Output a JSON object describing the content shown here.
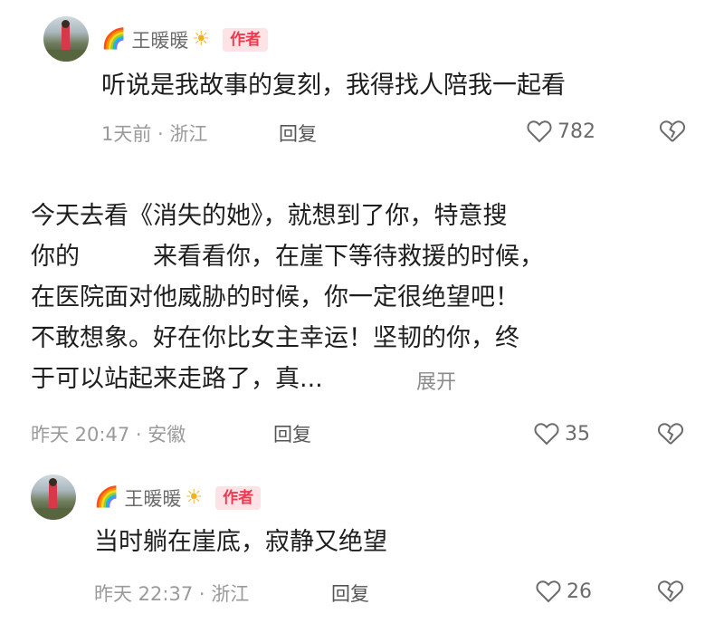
{
  "comments": [
    {
      "username": "王暖暖",
      "badge": "作者",
      "text_lines": [
        "听说是我故事的复刻，我得找人陪我一起看"
      ],
      "time_location": "1天前 · 浙江",
      "reply_label": "回复",
      "likes": "782"
    },
    {
      "text_lines": [
        "今天去看《消失的她》，就想到了你，特意搜",
        "你的　　　来看看你，在崖下等待救援的时候，",
        "在医院面对他威胁的时候，你一定很绝望吧！",
        "不敢想象。好在你比女主幸运！坚韧的你，终",
        "于可以站起来走路了，真..."
      ],
      "expand_label": "展开",
      "time_location": "昨天 20:47 · 安徽",
      "reply_label": "回复",
      "likes": "35"
    },
    {
      "username": "王暖暖",
      "badge": "作者",
      "text_lines": [
        "当时躺在崖底，寂静又绝望"
      ],
      "time_location": "昨天 22:37 · 浙江",
      "reply_label": "回复",
      "likes": "26"
    }
  ],
  "icons": {
    "rainbow": "🌈",
    "sun": "☀",
    "heart": "heart-icon",
    "dislike": "broken-heart-icon"
  },
  "colors": {
    "badge_text": "#f2384e",
    "badge_bg": "#fde3e6",
    "meta": "#9a9a9a",
    "text": "#1e1e1e"
  }
}
